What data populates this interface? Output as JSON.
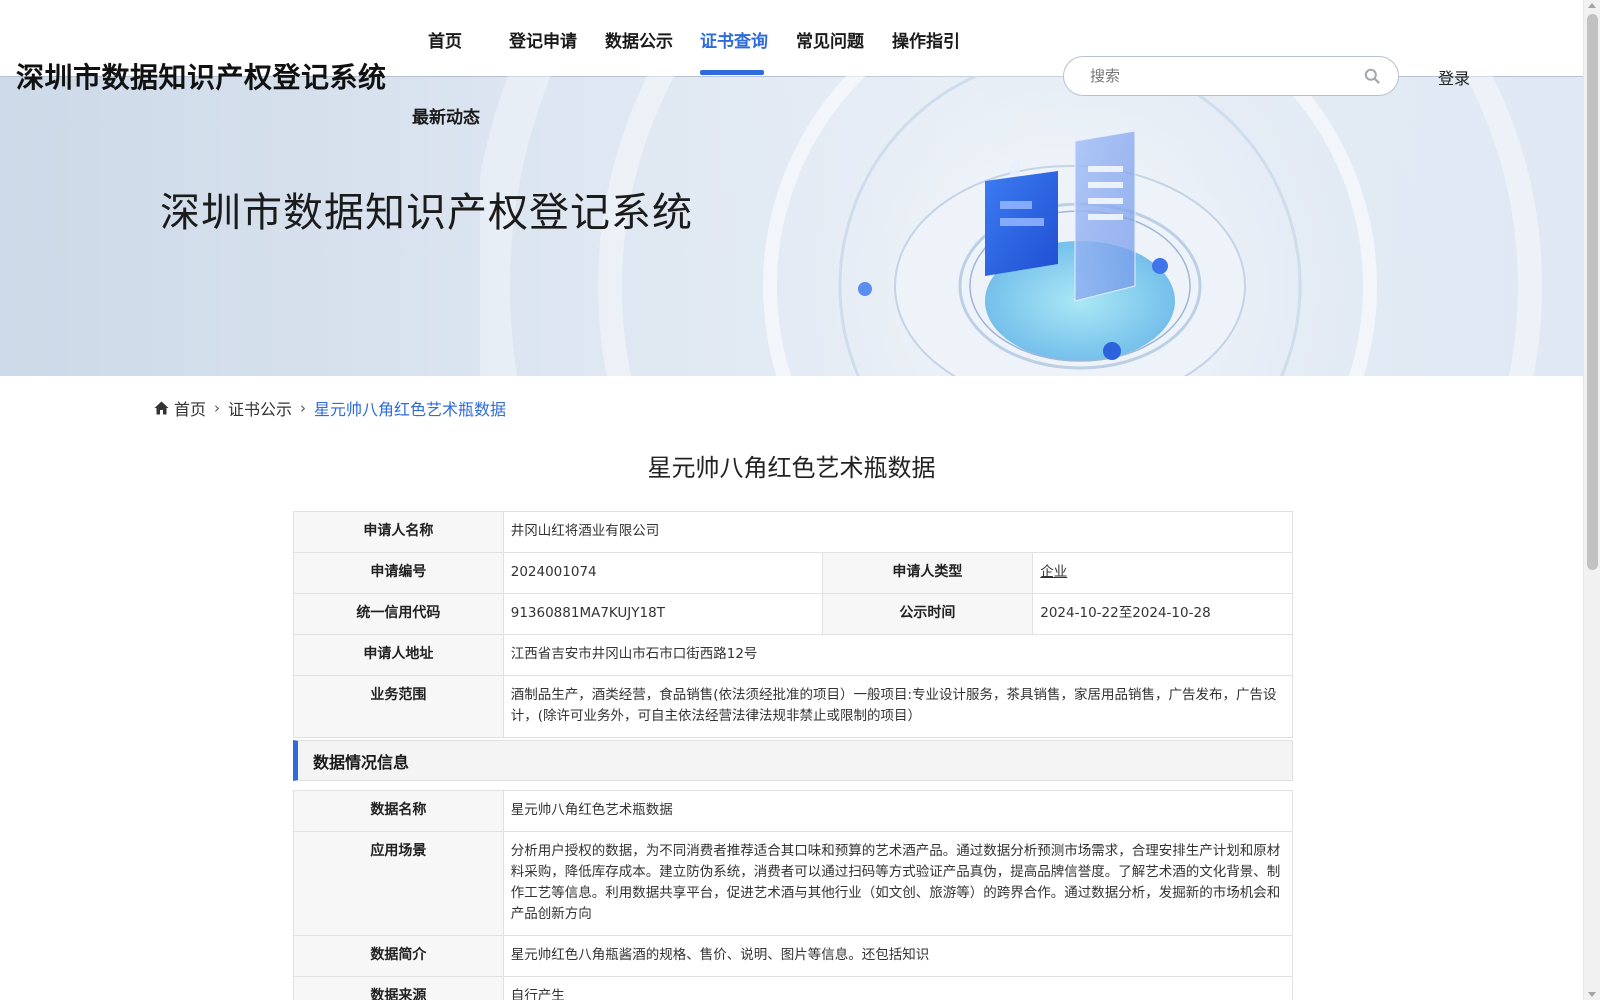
{
  "header": {
    "site_title": "深圳市数据知识产权登记系统",
    "nav": [
      {
        "label": "首页"
      },
      {
        "label": "登记申请"
      },
      {
        "label": "数据公示"
      },
      {
        "label": "证书查询",
        "active": true
      },
      {
        "label": "常见问题"
      },
      {
        "label": "操作指引"
      },
      {
        "label": "最新动态"
      }
    ],
    "search_placeholder": "搜索",
    "login_label": "登录",
    "accent_color": "#2f6bdc"
  },
  "banner": {
    "title": "深圳市数据知识产权登记系统"
  },
  "breadcrumb": {
    "home": "首页",
    "level2": "证书公示",
    "current": "星元帅八角红色艺术瓶数据"
  },
  "page_title": "星元帅八角红色艺术瓶数据",
  "applicant": {
    "name_label": "申请人名称",
    "name": "井冈山红将酒业有限公司",
    "app_no_label": "申请编号",
    "app_no": "2024001074",
    "type_label": "申请人类型",
    "type": "企业",
    "credit_code_label": "统一信用代码",
    "credit_code": "91360881MA7KUJY18T",
    "publish_time_label": "公示时间",
    "publish_time": "2024-10-22至2024-10-28",
    "address_label": "申请人地址",
    "address": "江西省吉安市井冈山市石市口街西路12号",
    "scope_label": "业务范围",
    "scope": "酒制品生产，酒类经营，食品销售(依法须经批准的项目）一般项目:专业设计服务，茶具销售，家居用品销售，广告发布，广告设计，(除许可业务外，可自主依法经营法律法规非禁止或限制的项目）"
  },
  "data_section": {
    "heading": "数据情况信息",
    "name_label": "数据名称",
    "name": "星元帅八角红色艺术瓶数据",
    "scene_label": "应用场景",
    "scene": "分析用户授权的数据，为不同消费者推荐适合其口味和预算的艺术酒产品。通过数据分析预测市场需求，合理安排生产计划和原材料采购，降低库存成本。建立防伪系统，消费者可以通过扫码等方式验证产品真伪，提高品牌信誉度。了解艺术酒的文化背景、制作工艺等信息。利用数据共享平台，促进艺术酒与其他行业（如文创、旅游等）的跨界合作。通过数据分析，发掘新的市场机会和产品创新方向",
    "intro_label": "数据简介",
    "intro": "星元帅红色八角瓶酱酒的规格、售价、说明、图片等信息。还包括知识",
    "source_label": "数据来源",
    "source": "自行产生"
  }
}
